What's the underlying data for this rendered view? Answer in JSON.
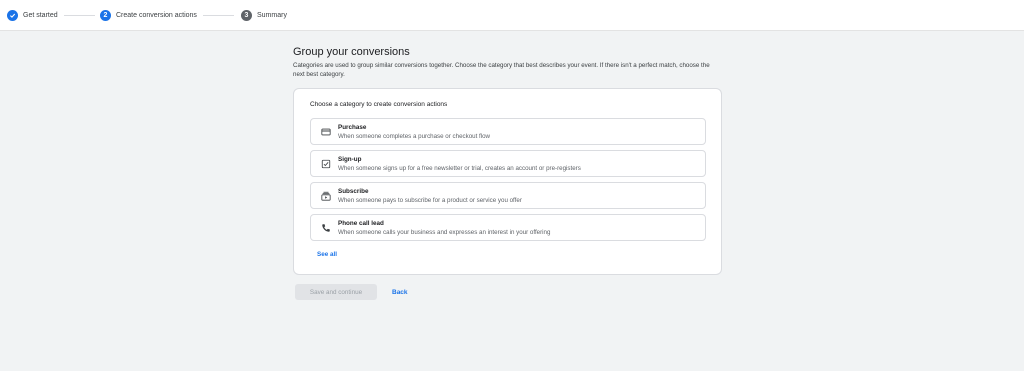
{
  "stepper": {
    "steps": [
      {
        "label": "Get started",
        "number": "",
        "state": "done"
      },
      {
        "label": "Create conversion actions",
        "number": "2",
        "state": "active"
      },
      {
        "label": "Summary",
        "number": "3",
        "state": "todo"
      }
    ]
  },
  "header": {
    "title": "Group your conversions",
    "description": "Categories are used to group similar conversions together. Choose the category that best describes your event. If there isn't a perfect match, choose the next best category."
  },
  "card": {
    "heading": "Choose a category to create conversion actions",
    "options": [
      {
        "title": "Purchase",
        "description": "When someone completes a purchase or checkout flow",
        "icon": "credit-card-icon"
      },
      {
        "title": "Sign-up",
        "description": "When someone signs up for a free newsletter or trial, creates an account or pre-registers",
        "icon": "checkbox-icon"
      },
      {
        "title": "Subscribe",
        "description": "When someone pays to subscribe for a product or service you offer",
        "icon": "subscriptions-icon"
      },
      {
        "title": "Phone call lead",
        "description": "When someone calls your business and expresses an interest in your offering",
        "icon": "phone-icon"
      }
    ],
    "see_all": "See all"
  },
  "actions": {
    "save_label": "Save and continue",
    "back_label": "Back"
  },
  "colors": {
    "accent": "#1a73e8",
    "background": "#f1f3f4",
    "card": "#ffffff",
    "disabled_button": "#e1e3e6"
  }
}
